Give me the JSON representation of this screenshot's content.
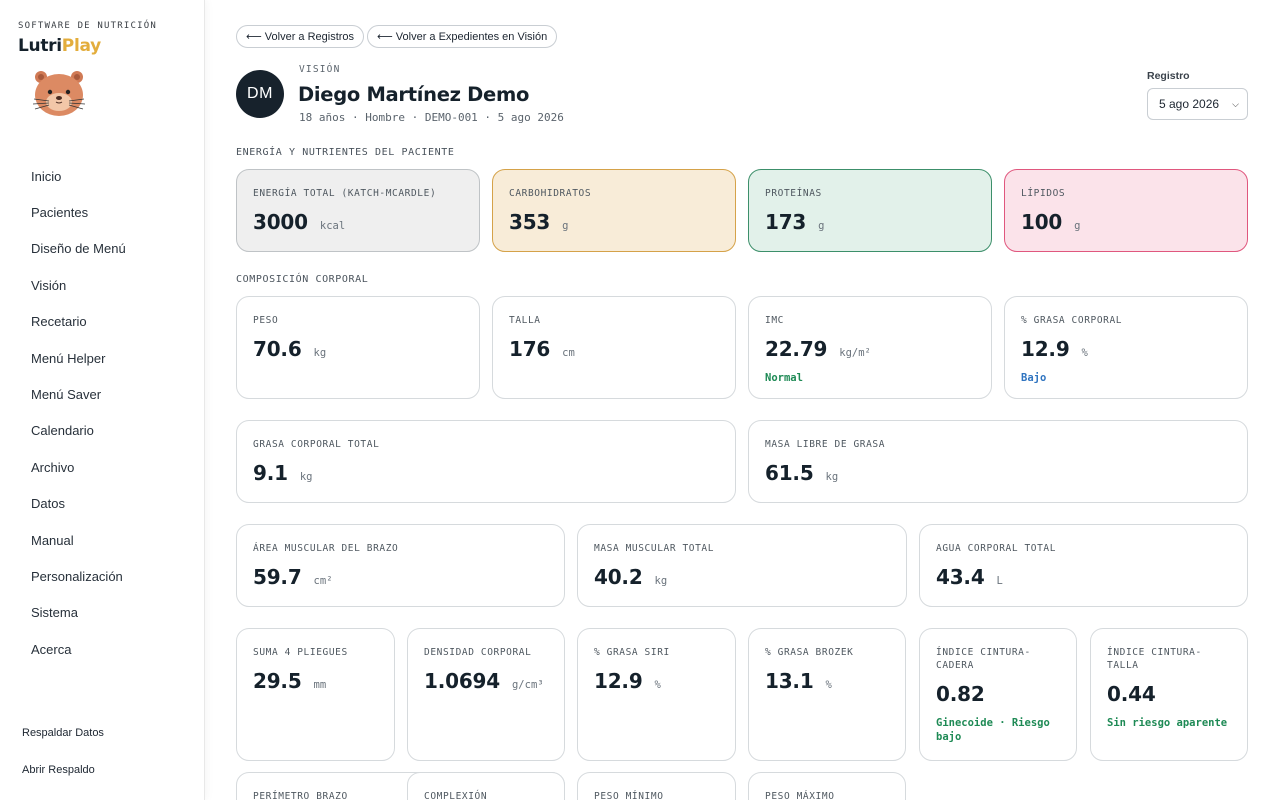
{
  "sidebar": {
    "tagline": "SOFTWARE DE NUTRICIÓN",
    "brand_part1": "Lutri",
    "brand_part2": "Play",
    "items": [
      {
        "label": "Inicio"
      },
      {
        "label": "Pacientes"
      },
      {
        "label": "Diseño de Menú"
      },
      {
        "label": "Visión"
      },
      {
        "label": "Recetario"
      },
      {
        "label": "Menú Helper"
      },
      {
        "label": "Menú Saver"
      },
      {
        "label": "Calendario"
      },
      {
        "label": "Archivo"
      },
      {
        "label": "Datos"
      },
      {
        "label": "Manual"
      },
      {
        "label": "Personalización"
      },
      {
        "label": "Sistema"
      },
      {
        "label": "Acerca"
      }
    ],
    "backup_label": "Respaldar Datos",
    "open_backup_label": "Abrir Respaldo"
  },
  "header": {
    "back_records": "Volver a Registros",
    "back_files": "Volver a Expedientes en Visión",
    "arrow": "⟵",
    "section": "VISIÓN",
    "avatar_initials": "DM",
    "patient_name": "Diego Martínez Demo",
    "patient_meta": "18 años · Hombre · DEMO-001 · 5 ago 2026",
    "registro_label": "Registro",
    "registro_value": "5 ago 2026",
    "chevron": "⌄"
  },
  "energy_section": {
    "title": "ENERGÍA Y NUTRIENTES DEL PACIENTE",
    "cards": [
      {
        "label": "ENERGÍA TOTAL (KATCH-MCARDLE)",
        "value": "3000",
        "unit": "kcal"
      },
      {
        "label": "CARBOHIDRATOS",
        "value": "353",
        "unit": "g"
      },
      {
        "label": "PROTEÍNAS",
        "value": "173",
        "unit": "g"
      },
      {
        "label": "LÍPIDOS",
        "value": "100",
        "unit": "g"
      }
    ]
  },
  "body_section": {
    "title": "COMPOSICIÓN CORPORAL",
    "row1": [
      {
        "label": "PESO",
        "value": "70.6",
        "unit": "kg",
        "note": ""
      },
      {
        "label": "TALLA",
        "value": "176",
        "unit": "cm",
        "note": ""
      },
      {
        "label": "IMC",
        "value": "22.79",
        "unit": "kg/m²",
        "note": "Normal"
      },
      {
        "label": "% GRASA CORPORAL",
        "value": "12.9",
        "unit": "%",
        "note": "Bajo"
      }
    ],
    "row2": [
      {
        "label": "GRASA CORPORAL TOTAL",
        "value": "9.1",
        "unit": "kg"
      },
      {
        "label": "MASA LIBRE DE GRASA",
        "value": "61.5",
        "unit": "kg"
      }
    ],
    "row3": [
      {
        "label": "ÁREA MUSCULAR DEL BRAZO",
        "value": "59.7",
        "unit": "cm²"
      },
      {
        "label": "MASA MUSCULAR TOTAL",
        "value": "40.2",
        "unit": "kg"
      },
      {
        "label": "AGUA CORPORAL TOTAL",
        "value": "43.4",
        "unit": "L"
      }
    ],
    "row4": [
      {
        "label": "SUMA 4 PLIEGUES",
        "value": "29.5",
        "unit": "mm",
        "note": ""
      },
      {
        "label": "DENSIDAD CORPORAL",
        "value": "1.0694",
        "unit": "g/cm³",
        "note": ""
      },
      {
        "label": "% GRASA SIRI",
        "value": "12.9",
        "unit": "%",
        "note": ""
      },
      {
        "label": "% GRASA BROZEK",
        "value": "13.1",
        "unit": "%",
        "note": ""
      },
      {
        "label": "ÍNDICE CINTURA-CADERA",
        "value": "0.82",
        "unit": "",
        "note": "Ginecoide · Riesgo bajo"
      },
      {
        "label": "ÍNDICE CINTURA-TALLA",
        "value": "0.44",
        "unit": "",
        "note": "Sin riesgo aparente"
      }
    ],
    "row5": [
      {
        "label": "PERÍMETRO BRAZO"
      },
      {
        "label": "COMPLEXIÓN"
      },
      {
        "label": "PESO MÍNIMO"
      },
      {
        "label": "PESO MÁXIMO"
      }
    ]
  },
  "colors": {
    "brand_accent": "#e3ad3c",
    "status_normal": "#1e8a55",
    "status_low": "#2f74c0",
    "status_green": "#1e8a55"
  }
}
